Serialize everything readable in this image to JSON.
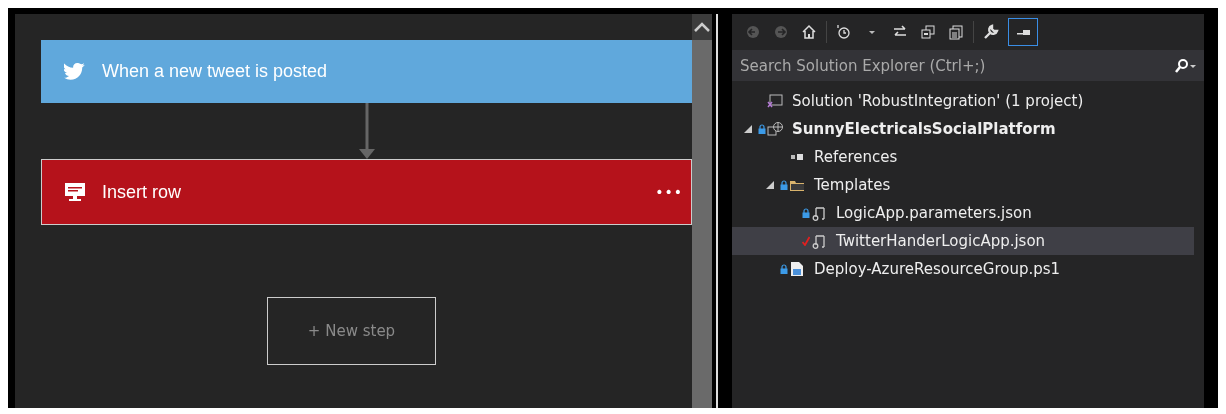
{
  "designer": {
    "steps": [
      {
        "kind": "trigger",
        "title": "When a new tweet is posted",
        "menu": false
      },
      {
        "kind": "sql",
        "title": "Insert row",
        "menu": true,
        "menu_label": "•••"
      }
    ],
    "new_step": "+ New step"
  },
  "solution_explorer": {
    "search": {
      "placeholder": "Search Solution Explorer (Ctrl+;)"
    },
    "tree": [
      {
        "kind": "solution",
        "label": "Solution 'RobustIntegration' (1 project)",
        "bold": false,
        "selected": false,
        "locked": false,
        "checked": false
      },
      {
        "kind": "project",
        "label": "SunnyElectricalsSocialPlatform",
        "bold": true,
        "selected": false,
        "locked": true,
        "checked": false,
        "expanded": true,
        "children": [
          {
            "kind": "references",
            "label": "References",
            "bold": false,
            "selected": false,
            "locked": false,
            "checked": false
          },
          {
            "kind": "folder",
            "label": "Templates",
            "bold": false,
            "selected": false,
            "locked": true,
            "checked": false,
            "expanded": true,
            "children": [
              {
                "kind": "json",
                "label": "LogicApp.parameters.json",
                "bold": false,
                "selected": false,
                "locked": true,
                "checked": false
              },
              {
                "kind": "json",
                "label": "TwitterHanderLogicApp.json",
                "bold": false,
                "selected": true,
                "locked": false,
                "checked": true
              }
            ]
          },
          {
            "kind": "script",
            "label": "Deploy-AzureResourceGroup.ps1",
            "bold": false,
            "selected": false,
            "locked": true,
            "checked": false
          }
        ]
      }
    ]
  }
}
